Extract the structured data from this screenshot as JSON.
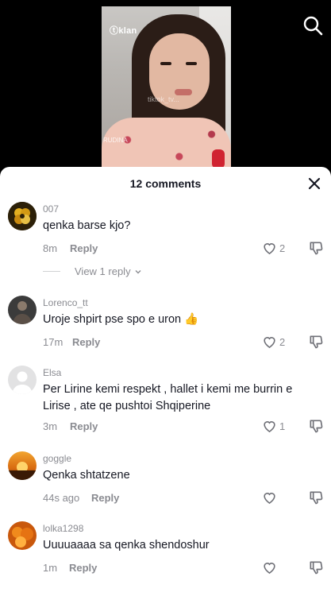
{
  "video": {
    "logo_text": "klan",
    "watermark": "tiktok_tv...",
    "name_tag": "RUDINA"
  },
  "sheet": {
    "title": "12 comments"
  },
  "icons": {
    "search": "search-icon",
    "close": "close-icon",
    "like": "heart-outline-icon",
    "dislike": "thumbs-down-icon",
    "chevron": "chevron-down-icon"
  },
  "comments": [
    {
      "username": "007",
      "text": "qenka barse kjo?",
      "time": "8m",
      "reply": "Reply",
      "likes": "2",
      "avatar_color": "#3a2a10"
    },
    {
      "username": "Lorenco_tt",
      "text": "Uroje shpirt pse spo e uron 👍",
      "time": "17m",
      "reply": "Reply",
      "likes": "2",
      "avatar_color": "#4a4a4a"
    },
    {
      "username": "Elsa",
      "text": "Per Lirine kemi respekt , hallet i kemi me burrin e Lirise , ate qe pushtoi Shqiperine",
      "time": "3m",
      "reply": "Reply",
      "likes": "1",
      "avatar_color": "#dcdcdc"
    },
    {
      "username": "goggle",
      "text": "Qenka shtatzene",
      "time": "44s ago",
      "reply": "Reply",
      "likes": "",
      "avatar_color": "#e88a1a"
    },
    {
      "username": "lolka1298",
      "text": "Uuuuaaaa sa qenka shendoshur",
      "time": "1m",
      "reply": "Reply",
      "likes": "",
      "avatar_color": "#d86a12"
    }
  ],
  "view_replies": {
    "label": "View 1 reply"
  }
}
